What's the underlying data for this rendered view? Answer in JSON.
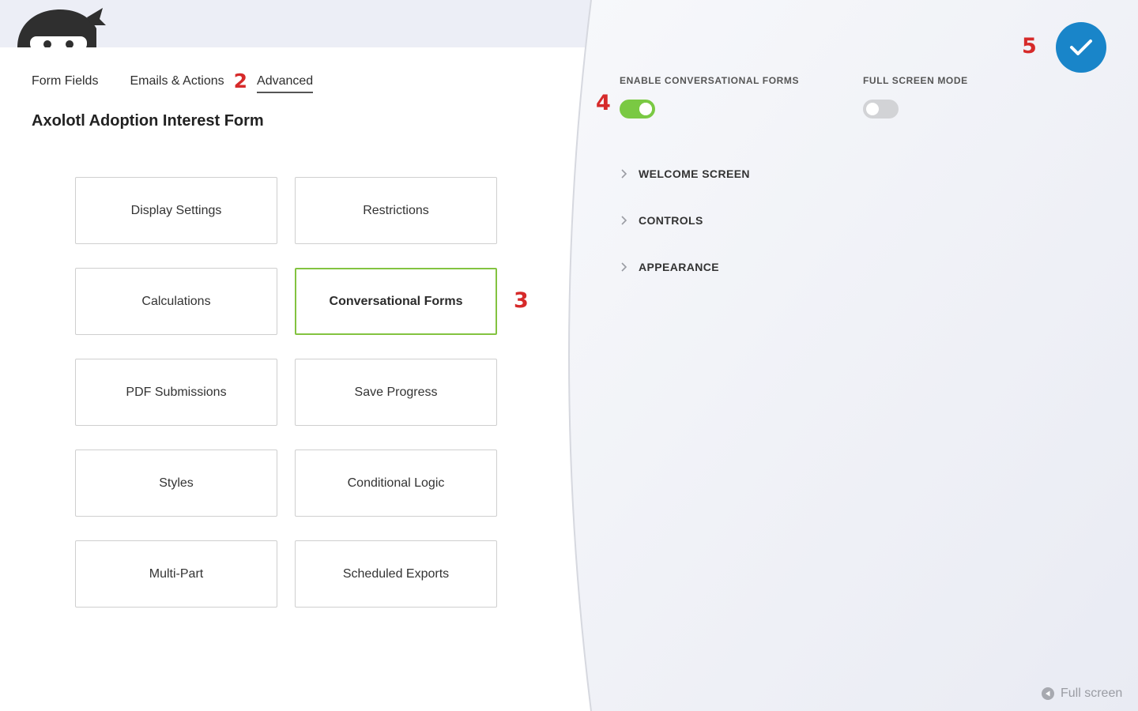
{
  "tabs": {
    "form_fields": "Form Fields",
    "emails_actions": "Emails & Actions",
    "advanced": "Advanced"
  },
  "annotations": {
    "n2": "2",
    "n3": "3",
    "n4": "4",
    "n5": "5"
  },
  "form_title": "Axolotl Adoption Interest Form",
  "cards": [
    "Display Settings",
    "Restrictions",
    "Calculations",
    "Conversational Forms",
    "PDF Submissions",
    "Save Progress",
    "Styles",
    "Conditional Logic",
    "Multi-Part",
    "Scheduled Exports"
  ],
  "selected_card": "Conversational Forms",
  "panel": {
    "enable_label": "ENABLE CONVERSATIONAL FORMS",
    "enable_state": true,
    "fullscreen_label": "FULL SCREEN MODE",
    "fullscreen_state": false,
    "sections": [
      "WELCOME SCREEN",
      "CONTROLS",
      "APPEARANCE"
    ],
    "fullscreen_link": "Full screen"
  },
  "colors": {
    "accent_green": "#7ac943",
    "selected_border": "#83c340",
    "confirm_blue": "#1985c9",
    "annotation_red": "#d62a2a"
  },
  "icons": [
    "ninja-logo-icon",
    "checkmark-icon",
    "chevron-right-icon",
    "play-circle-icon"
  ]
}
